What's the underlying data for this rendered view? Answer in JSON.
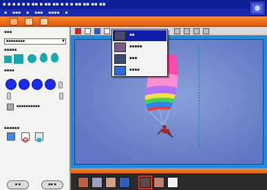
{
  "window": {
    "title": "▪ ▪ ▪ ▪ ▪ ▪ ▪▪ ▪ ▪▪ ▪▪ ▪ ▪ ▪ ▪▪ ▪▪ ▪▪ ▪▪"
  },
  "menubar": {
    "items": [
      "▪",
      "▪▪▪",
      "▪",
      "▪▪▪",
      "▪▪▪▪",
      "▪"
    ]
  },
  "left_panel": {
    "section1_label": "▪▪▪",
    "dropdown_value": "▪▪▪▪▪▪▪▪",
    "section2_label": "▪▪▪▪▪",
    "section3_label": "▪▪▪▪",
    "checkbox_label": "▪▪▪▪▪▪▪▪▪▪",
    "section4_label": "▪▪▪▪▪▪",
    "bottom_btn_left": "▪  ▪",
    "bottom_btn_right": "▪▪  ▪"
  },
  "popup_menu": {
    "items": [
      {
        "label": "▪▪",
        "selected": true
      },
      {
        "label": "▪▪▪▪▪",
        "selected": false
      },
      {
        "label": "▪▪▪",
        "selected": false
      },
      {
        "label": "▪▪▪▪",
        "selected": false
      }
    ]
  },
  "colors": {
    "accent_orange": "#ff7a20",
    "title_blue": "#0e1f9a",
    "shape_teal": "#17a7b0",
    "circle_blue": "#1b2cf0",
    "canvas_blue": "#1b8de0"
  }
}
